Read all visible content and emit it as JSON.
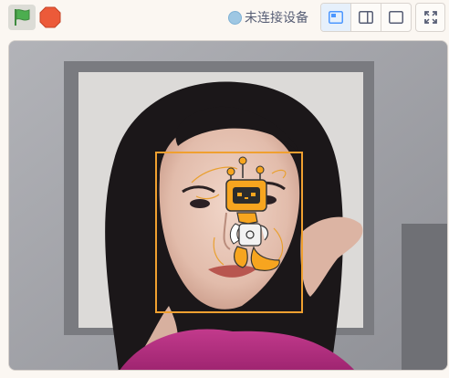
{
  "toolbar": {
    "green_flag_icon": "green-flag-icon",
    "stop_icon": "stop-sign-icon",
    "connection_status": "未连接设备",
    "status_dot_color": "#9ec7e3",
    "layout_buttons": [
      {
        "icon": "small-stage-layout-icon",
        "active": true
      },
      {
        "icon": "sidebar-layout-icon",
        "active": false
      },
      {
        "icon": "large-stage-layout-icon",
        "active": false
      }
    ],
    "fullscreen_icon": "fullscreen-icon"
  },
  "stage": {
    "camera_feed": "webcam-video-feed",
    "face_detection_box_color": "#f0a030",
    "sprite": "robot-sprite"
  },
  "colors": {
    "accent_orange": "#f7a51f",
    "flag_green": "#4cae4f",
    "stop_red": "#ec5a39",
    "layout_active_blue": "#4c97ff"
  }
}
